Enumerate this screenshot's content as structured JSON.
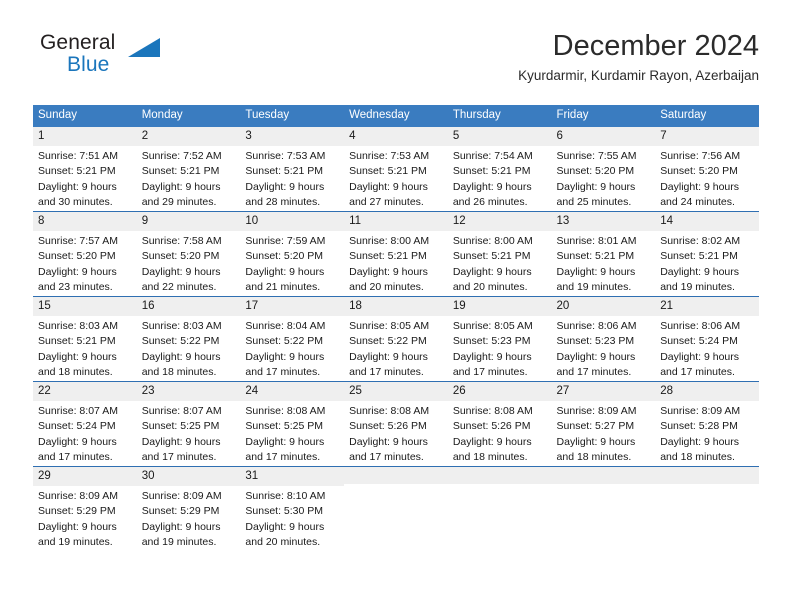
{
  "brand": {
    "name_part1": "General",
    "name_part2": "Blue",
    "logo_icon": "triangle-icon",
    "accent_color": "#1b76bc"
  },
  "header": {
    "month_title": "December 2024",
    "location": "Kyurdarmir, Kurdamir Rayon, Azerbaijan"
  },
  "calendar": {
    "header_background": "#3a7cc0",
    "daynum_background": "#efefef",
    "row_separator_color": "#2f6fb2",
    "weekday_headers": [
      "Sunday",
      "Monday",
      "Tuesday",
      "Wednesday",
      "Thursday",
      "Friday",
      "Saturday"
    ],
    "weeks": [
      [
        {
          "day": "1",
          "sunrise": "Sunrise: 7:51 AM",
          "sunset": "Sunset: 5:21 PM",
          "daylight_line1": "Daylight: 9 hours",
          "daylight_line2": "and 30 minutes."
        },
        {
          "day": "2",
          "sunrise": "Sunrise: 7:52 AM",
          "sunset": "Sunset: 5:21 PM",
          "daylight_line1": "Daylight: 9 hours",
          "daylight_line2": "and 29 minutes."
        },
        {
          "day": "3",
          "sunrise": "Sunrise: 7:53 AM",
          "sunset": "Sunset: 5:21 PM",
          "daylight_line1": "Daylight: 9 hours",
          "daylight_line2": "and 28 minutes."
        },
        {
          "day": "4",
          "sunrise": "Sunrise: 7:53 AM",
          "sunset": "Sunset: 5:21 PM",
          "daylight_line1": "Daylight: 9 hours",
          "daylight_line2": "and 27 minutes."
        },
        {
          "day": "5",
          "sunrise": "Sunrise: 7:54 AM",
          "sunset": "Sunset: 5:21 PM",
          "daylight_line1": "Daylight: 9 hours",
          "daylight_line2": "and 26 minutes."
        },
        {
          "day": "6",
          "sunrise": "Sunrise: 7:55 AM",
          "sunset": "Sunset: 5:20 PM",
          "daylight_line1": "Daylight: 9 hours",
          "daylight_line2": "and 25 minutes."
        },
        {
          "day": "7",
          "sunrise": "Sunrise: 7:56 AM",
          "sunset": "Sunset: 5:20 PM",
          "daylight_line1": "Daylight: 9 hours",
          "daylight_line2": "and 24 minutes."
        }
      ],
      [
        {
          "day": "8",
          "sunrise": "Sunrise: 7:57 AM",
          "sunset": "Sunset: 5:20 PM",
          "daylight_line1": "Daylight: 9 hours",
          "daylight_line2": "and 23 minutes."
        },
        {
          "day": "9",
          "sunrise": "Sunrise: 7:58 AM",
          "sunset": "Sunset: 5:20 PM",
          "daylight_line1": "Daylight: 9 hours",
          "daylight_line2": "and 22 minutes."
        },
        {
          "day": "10",
          "sunrise": "Sunrise: 7:59 AM",
          "sunset": "Sunset: 5:20 PM",
          "daylight_line1": "Daylight: 9 hours",
          "daylight_line2": "and 21 minutes."
        },
        {
          "day": "11",
          "sunrise": "Sunrise: 8:00 AM",
          "sunset": "Sunset: 5:21 PM",
          "daylight_line1": "Daylight: 9 hours",
          "daylight_line2": "and 20 minutes."
        },
        {
          "day": "12",
          "sunrise": "Sunrise: 8:00 AM",
          "sunset": "Sunset: 5:21 PM",
          "daylight_line1": "Daylight: 9 hours",
          "daylight_line2": "and 20 minutes."
        },
        {
          "day": "13",
          "sunrise": "Sunrise: 8:01 AM",
          "sunset": "Sunset: 5:21 PM",
          "daylight_line1": "Daylight: 9 hours",
          "daylight_line2": "and 19 minutes."
        },
        {
          "day": "14",
          "sunrise": "Sunrise: 8:02 AM",
          "sunset": "Sunset: 5:21 PM",
          "daylight_line1": "Daylight: 9 hours",
          "daylight_line2": "and 19 minutes."
        }
      ],
      [
        {
          "day": "15",
          "sunrise": "Sunrise: 8:03 AM",
          "sunset": "Sunset: 5:21 PM",
          "daylight_line1": "Daylight: 9 hours",
          "daylight_line2": "and 18 minutes."
        },
        {
          "day": "16",
          "sunrise": "Sunrise: 8:03 AM",
          "sunset": "Sunset: 5:22 PM",
          "daylight_line1": "Daylight: 9 hours",
          "daylight_line2": "and 18 minutes."
        },
        {
          "day": "17",
          "sunrise": "Sunrise: 8:04 AM",
          "sunset": "Sunset: 5:22 PM",
          "daylight_line1": "Daylight: 9 hours",
          "daylight_line2": "and 17 minutes."
        },
        {
          "day": "18",
          "sunrise": "Sunrise: 8:05 AM",
          "sunset": "Sunset: 5:22 PM",
          "daylight_line1": "Daylight: 9 hours",
          "daylight_line2": "and 17 minutes."
        },
        {
          "day": "19",
          "sunrise": "Sunrise: 8:05 AM",
          "sunset": "Sunset: 5:23 PM",
          "daylight_line1": "Daylight: 9 hours",
          "daylight_line2": "and 17 minutes."
        },
        {
          "day": "20",
          "sunrise": "Sunrise: 8:06 AM",
          "sunset": "Sunset: 5:23 PM",
          "daylight_line1": "Daylight: 9 hours",
          "daylight_line2": "and 17 minutes."
        },
        {
          "day": "21",
          "sunrise": "Sunrise: 8:06 AM",
          "sunset": "Sunset: 5:24 PM",
          "daylight_line1": "Daylight: 9 hours",
          "daylight_line2": "and 17 minutes."
        }
      ],
      [
        {
          "day": "22",
          "sunrise": "Sunrise: 8:07 AM",
          "sunset": "Sunset: 5:24 PM",
          "daylight_line1": "Daylight: 9 hours",
          "daylight_line2": "and 17 minutes."
        },
        {
          "day": "23",
          "sunrise": "Sunrise: 8:07 AM",
          "sunset": "Sunset: 5:25 PM",
          "daylight_line1": "Daylight: 9 hours",
          "daylight_line2": "and 17 minutes."
        },
        {
          "day": "24",
          "sunrise": "Sunrise: 8:08 AM",
          "sunset": "Sunset: 5:25 PM",
          "daylight_line1": "Daylight: 9 hours",
          "daylight_line2": "and 17 minutes."
        },
        {
          "day": "25",
          "sunrise": "Sunrise: 8:08 AM",
          "sunset": "Sunset: 5:26 PM",
          "daylight_line1": "Daylight: 9 hours",
          "daylight_line2": "and 17 minutes."
        },
        {
          "day": "26",
          "sunrise": "Sunrise: 8:08 AM",
          "sunset": "Sunset: 5:26 PM",
          "daylight_line1": "Daylight: 9 hours",
          "daylight_line2": "and 18 minutes."
        },
        {
          "day": "27",
          "sunrise": "Sunrise: 8:09 AM",
          "sunset": "Sunset: 5:27 PM",
          "daylight_line1": "Daylight: 9 hours",
          "daylight_line2": "and 18 minutes."
        },
        {
          "day": "28",
          "sunrise": "Sunrise: 8:09 AM",
          "sunset": "Sunset: 5:28 PM",
          "daylight_line1": "Daylight: 9 hours",
          "daylight_line2": "and 18 minutes."
        }
      ],
      [
        {
          "day": "29",
          "sunrise": "Sunrise: 8:09 AM",
          "sunset": "Sunset: 5:29 PM",
          "daylight_line1": "Daylight: 9 hours",
          "daylight_line2": "and 19 minutes."
        },
        {
          "day": "30",
          "sunrise": "Sunrise: 8:09 AM",
          "sunset": "Sunset: 5:29 PM",
          "daylight_line1": "Daylight: 9 hours",
          "daylight_line2": "and 19 minutes."
        },
        {
          "day": "31",
          "sunrise": "Sunrise: 8:10 AM",
          "sunset": "Sunset: 5:30 PM",
          "daylight_line1": "Daylight: 9 hours",
          "daylight_line2": "and 20 minutes."
        },
        {
          "day": "",
          "sunrise": "",
          "sunset": "",
          "daylight_line1": "",
          "daylight_line2": ""
        },
        {
          "day": "",
          "sunrise": "",
          "sunset": "",
          "daylight_line1": "",
          "daylight_line2": ""
        },
        {
          "day": "",
          "sunrise": "",
          "sunset": "",
          "daylight_line1": "",
          "daylight_line2": ""
        },
        {
          "day": "",
          "sunrise": "",
          "sunset": "",
          "daylight_line1": "",
          "daylight_line2": ""
        }
      ]
    ]
  }
}
